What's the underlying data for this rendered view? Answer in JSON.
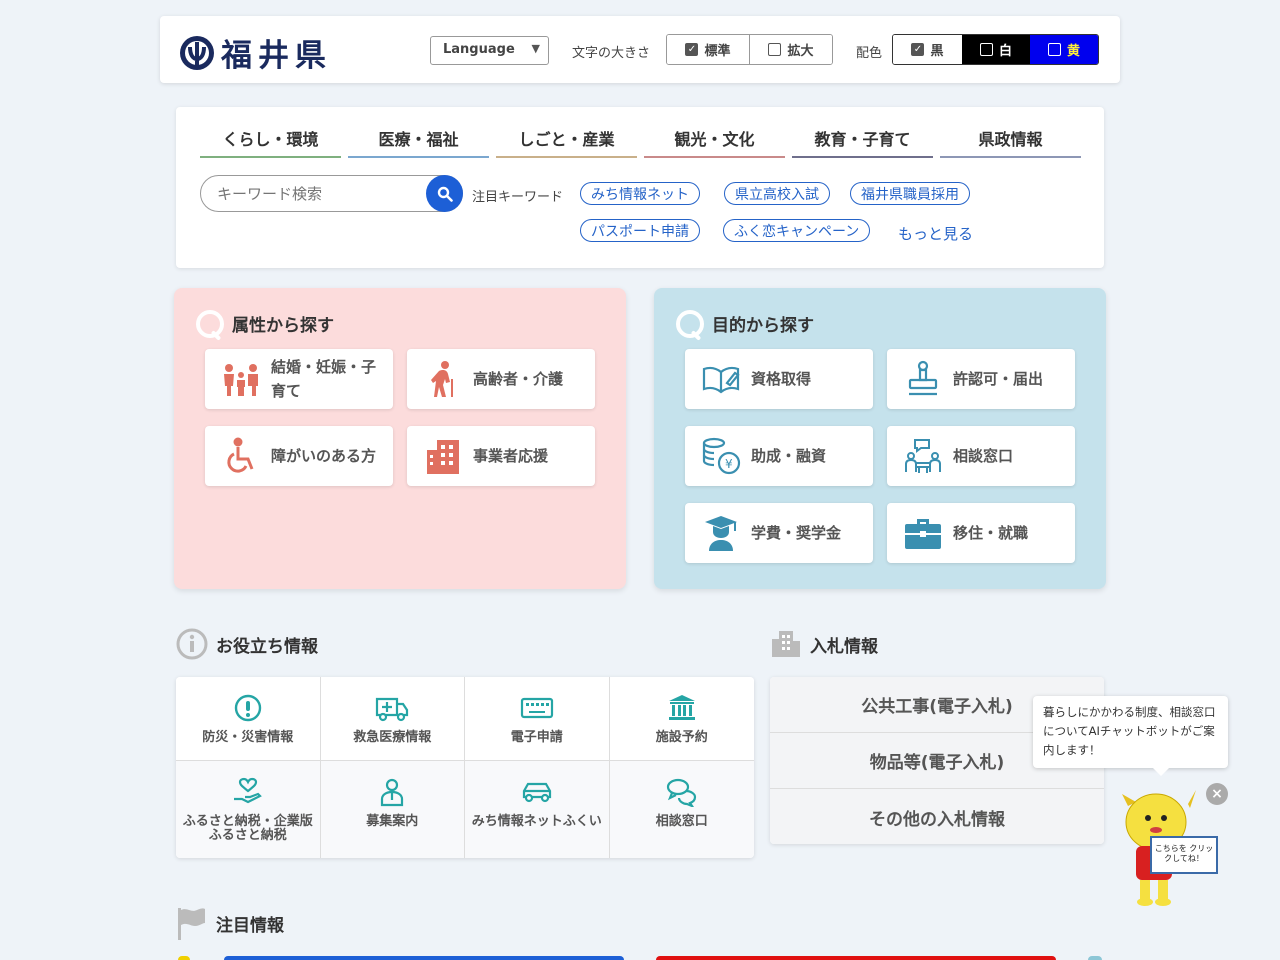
{
  "header": {
    "logo_text": "福井県",
    "language_label": "Language",
    "font_size_label": "文字の大きさ",
    "font_size_options": [
      "標準",
      "拡大"
    ],
    "color_label": "配色",
    "color_options": [
      "黒",
      "白",
      "黄"
    ]
  },
  "nav": {
    "tabs": [
      {
        "label": "くらし・環境",
        "color": "#7fb07f"
      },
      {
        "label": "医療・福祉",
        "color": "#7ba7cf"
      },
      {
        "label": "しごと・産業",
        "color": "#c9b08a"
      },
      {
        "label": "観光・文化",
        "color": "#c98a8a"
      },
      {
        "label": "教育・子育て",
        "color": "#6f6f8c"
      },
      {
        "label": "県政情報",
        "color": "#8d97b5"
      }
    ],
    "search_placeholder": "キーワード検索",
    "keywords_label": "注目キーワード",
    "keywords": [
      "みち情報ネット",
      "県立高校入試",
      "福井県職員採用",
      "パスポート申請",
      "ふく恋キャンペーン"
    ],
    "more_label": "もっと見る"
  },
  "attribute_panel": {
    "title": "属性から探す",
    "items": [
      "結婚・妊娠・子育て",
      "高齢者・介護",
      "障がいのある方",
      "事業者応援"
    ]
  },
  "purpose_panel": {
    "title": "目的から探す",
    "items": [
      "資格取得",
      "許認可・届出",
      "助成・融資",
      "相談窓口",
      "学費・奨学金",
      "移住・就職"
    ]
  },
  "useful": {
    "title": "お役立ち情報",
    "items": [
      "防災・災害情報",
      "救急医療情報",
      "電子申請",
      "施設予約",
      "ふるさと納税・企業版ふるさと納税",
      "募集案内",
      "みち情報ネットふくい",
      "相談窓口"
    ]
  },
  "bidding": {
    "title": "入札情報",
    "items": [
      "公共工事(電子入札)",
      "物品等(電子入札)",
      "その他の入札情報"
    ]
  },
  "featured": {
    "title": "注目情報"
  },
  "chatbot": {
    "message": "暮らしにかかわる制度、相談窓口についてAIチャットボットがご案内します！",
    "sign_text": "こちらを クリックしてね！",
    "close_label": "×"
  },
  "colors": {
    "accent_blue": "#1d5fd6",
    "pink_panel": "#fcdcdc",
    "blue_panel": "#c5e2ec",
    "attribute_icon": "#e07060",
    "purpose_icon": "#3a8fb0",
    "useful_icon": "#25a5a5"
  }
}
